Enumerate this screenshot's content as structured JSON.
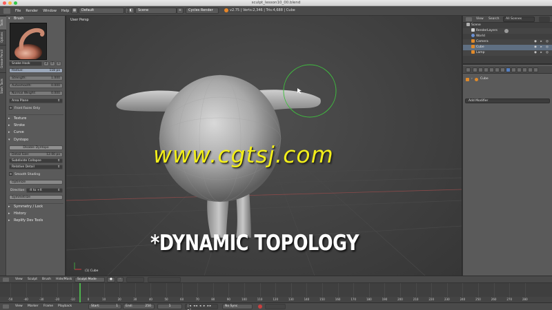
{
  "window": {
    "title": "sculpt_lesson10_00.blend"
  },
  "info_header": {
    "menus": [
      "File",
      "Render",
      "Window",
      "Help"
    ],
    "layout": "Default",
    "scene": "Scene",
    "engine": "Cycles Render",
    "stats": "v2.75 | Verts:2,346 | Tris:4,688 | Cube"
  },
  "tool_panel": {
    "tabs": [
      "Tools",
      "Options",
      "Grease Pencil",
      "Slash Tools"
    ],
    "brush_header": "Brush",
    "brush_name": "Snake Hook",
    "brush_users": "2",
    "brush_btn_f": "F",
    "radius_label": "Radius:",
    "radius_value": "118 px",
    "strength_label": "Strength:",
    "strength_value": "1.000",
    "autosmooth_label": "Autosmooth:",
    "autosmooth_value": "0.000",
    "normal_weight_label": "Normal Weight:",
    "normal_weight_value": "0.000",
    "area_plane": "Area Plane",
    "front_faces": "Front Faces Only",
    "sections": [
      "Texture",
      "Stroke",
      "Curve"
    ],
    "dyntopo_header": "Dyntopo",
    "disable_dyntopo": "Disable Dyntopo",
    "detail_size_label": "Detail Size:",
    "detail_size_value": "12.00 px",
    "subdivide": "Subdivide Collapse",
    "relative_detail": "Relative Detail",
    "smooth_shading": "Smooth Shading",
    "optimize": "Optimize",
    "direction_label": "Direction:",
    "direction_value": "-X to +X",
    "symmetrize": "Symmetrize",
    "more_sections": [
      "Symmetry / Lock",
      "History",
      "Replify Dev Tools"
    ]
  },
  "viewport": {
    "view_label": "User Persp",
    "object_label": "(1) Cube",
    "watermark": "www.cgtsj.com",
    "caption": "*DYNAMIC TOPOLOGY"
  },
  "outliner": {
    "menu_view": "View",
    "menu_search": "Search",
    "filter": "All Scenes",
    "rows": [
      {
        "label": "Scene",
        "color": "#b0b0b0"
      },
      {
        "label": "RenderLayers",
        "color": "#d0d0d0"
      },
      {
        "label": "World",
        "color": "#6a8fd0"
      },
      {
        "label": "Camera",
        "color": "#e08a2a"
      },
      {
        "label": "Cube",
        "color": "#e08a2a"
      },
      {
        "label": "Lamp",
        "color": "#e08a2a"
      }
    ]
  },
  "properties": {
    "object_name": "Cube",
    "add_modifier": "Add Modifier"
  },
  "sculpt_header": {
    "items": [
      "View",
      "Sculpt",
      "Brush",
      "Hide/Mask"
    ],
    "mode": "Sculpt Mode"
  },
  "timeline": {
    "ticks": [
      "-50",
      "-40",
      "-30",
      "-20",
      "-10",
      "0",
      "10",
      "20",
      "30",
      "40",
      "50",
      "60",
      "70",
      "80",
      "90",
      "100",
      "110",
      "120",
      "130",
      "140",
      "150",
      "160",
      "170",
      "180",
      "190",
      "200",
      "210",
      "220",
      "230",
      "240",
      "250",
      "260",
      "270",
      "280"
    ],
    "menus": [
      "View",
      "Marker",
      "Frame",
      "Playback"
    ],
    "start_label": "Start:",
    "start_value": "1",
    "end_label": "End:",
    "end_value": "250",
    "current_frame": "1",
    "sync": "No Sync"
  },
  "colors": {
    "accent": "#5680c2",
    "watermark": "#f2ee1a",
    "cursor_ring": "#3fbf3f",
    "playhead": "#4db34d"
  }
}
